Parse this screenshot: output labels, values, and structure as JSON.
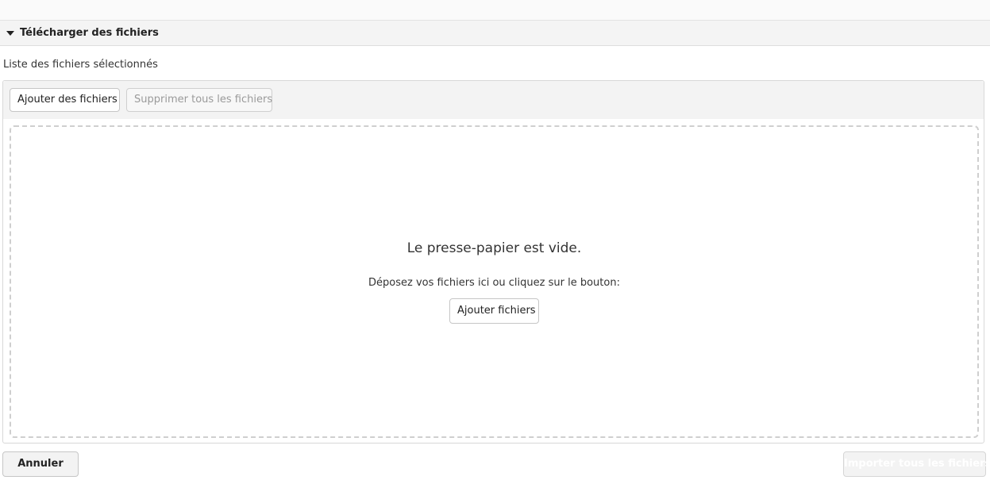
{
  "section": {
    "title": "Télécharger des fichiers"
  },
  "uploader": {
    "list_label": "Liste des fichiers sélectionnés",
    "toolbar": {
      "add_files_label": "Ajouter des fichiers",
      "remove_all_label": "Supprimer tous les fichiers"
    },
    "dropzone": {
      "empty_title": "Le presse-papier est vide.",
      "hint": "Déposez vos fichiers ici ou cliquez sur le bouton:",
      "add_button_label": "Ajouter fichiers"
    }
  },
  "footer": {
    "cancel_label": "Annuler",
    "import_all_label": "Importer tous les fichiers"
  }
}
